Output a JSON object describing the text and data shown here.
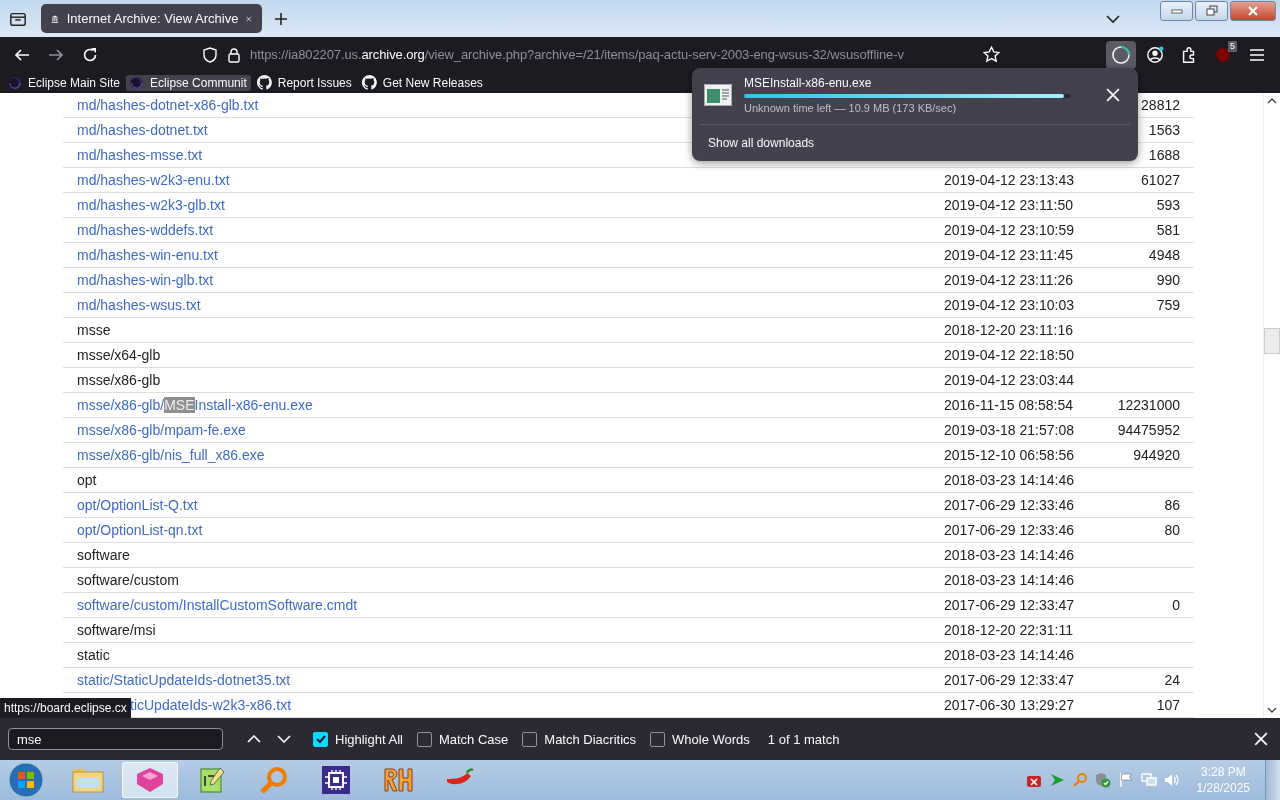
{
  "tabs": [
    {
      "title": "Internet Archive: View Archive",
      "selected": true
    }
  ],
  "url": {
    "prefix": "https://ia802207.us.",
    "domain": "archive.org",
    "path": "/view_archive.php?archive=/21/items/paq-actu-serv-2003-eng-wsus-32/wsusoffline-v"
  },
  "bookmarks": [
    {
      "label": "Eclipse Main Site",
      "kind": "eclipse",
      "hovered": false
    },
    {
      "label": "Eclipse Communit",
      "kind": "eclipse",
      "hovered": true
    },
    {
      "label": "Report Issues",
      "kind": "github",
      "hovered": false
    },
    {
      "label": "Get New Releases",
      "kind": "github",
      "hovered": false
    }
  ],
  "extension_badge": "5",
  "download": {
    "filename": "MSEInstall-x86-enu.exe",
    "level": 0.98,
    "status": "Unknown time left — 10.9 MB (173 KB/sec)",
    "show_all": "Show all downloads"
  },
  "rows": [
    {
      "kind": "file",
      "name": [
        {
          "text": "md/hashes-dotnet-x86-glb.txt",
          "highlighted": false
        }
      ],
      "size": "28812"
    },
    {
      "kind": "file",
      "name": [
        {
          "text": "md/hashes-dotnet.txt",
          "highlighted": false
        }
      ],
      "size": "1563"
    },
    {
      "kind": "file",
      "name": [
        {
          "text": "md/hashes-msse.txt",
          "highlighted": false
        }
      ],
      "size": "1688"
    },
    {
      "kind": "file",
      "name": [
        {
          "text": "md/hashes-w2k3-enu.txt",
          "highlighted": false
        }
      ],
      "date": "2019-04-12 23:13:43",
      "size": "61027"
    },
    {
      "kind": "file",
      "name": [
        {
          "text": "md/hashes-w2k3-glb.txt",
          "highlighted": false
        }
      ],
      "date": "2019-04-12 23:11:50",
      "size": "593"
    },
    {
      "kind": "file",
      "name": [
        {
          "text": "md/hashes-wddefs.txt",
          "highlighted": false
        }
      ],
      "date": "2019-04-12 23:10:59",
      "size": "581"
    },
    {
      "kind": "file",
      "name": [
        {
          "text": "md/hashes-win-enu.txt",
          "highlighted": false
        }
      ],
      "date": "2019-04-12 23:11:45",
      "size": "4948"
    },
    {
      "kind": "file",
      "name": [
        {
          "text": "md/hashes-win-glb.txt",
          "highlighted": false
        }
      ],
      "date": "2019-04-12 23:11:26",
      "size": "990"
    },
    {
      "kind": "file",
      "name": [
        {
          "text": "md/hashes-wsus.txt",
          "highlighted": false
        }
      ],
      "date": "2019-04-12 23:10:03",
      "size": "759"
    },
    {
      "kind": "folder",
      "name": [
        {
          "text": "msse",
          "highlighted": false
        }
      ],
      "date": "2018-12-20 23:11:16"
    },
    {
      "kind": "folder",
      "name": [
        {
          "text": "msse/x64-glb",
          "highlighted": false
        }
      ],
      "date": "2019-04-12 22:18:50"
    },
    {
      "kind": "folder",
      "name": [
        {
          "text": "msse/x86-glb",
          "highlighted": false
        }
      ],
      "date": "2019-04-12 23:03:44"
    },
    {
      "kind": "file",
      "name": [
        {
          "text": "msse/x86-glb/",
          "highlighted": false
        },
        {
          "text": "MSE",
          "highlighted": true
        },
        {
          "text": "Install-x86-enu.exe",
          "highlighted": false
        }
      ],
      "date": "2016-11-15 08:58:54",
      "size": "12231000"
    },
    {
      "kind": "file",
      "name": [
        {
          "text": "msse/x86-glb/mpam-fe.exe",
          "highlighted": false
        }
      ],
      "date": "2019-03-18 21:57:08",
      "size": "94475952"
    },
    {
      "kind": "file",
      "name": [
        {
          "text": "msse/x86-glb/nis_full_x86.exe",
          "highlighted": false
        }
      ],
      "date": "2015-12-10 06:58:56",
      "size": "944920"
    },
    {
      "kind": "folder",
      "name": [
        {
          "text": "opt",
          "highlighted": false
        }
      ],
      "date": "2018-03-23 14:14:46"
    },
    {
      "kind": "file",
      "name": [
        {
          "text": "opt/OptionList-Q.txt",
          "highlighted": false
        }
      ],
      "date": "2017-06-29 12:33:46",
      "size": "86"
    },
    {
      "kind": "file",
      "name": [
        {
          "text": "opt/OptionList-qn.txt",
          "highlighted": false
        }
      ],
      "date": "2017-06-29 12:33:46",
      "size": "80"
    },
    {
      "kind": "folder",
      "name": [
        {
          "text": "software",
          "highlighted": false
        }
      ],
      "date": "2018-03-23 14:14:46"
    },
    {
      "kind": "folder",
      "name": [
        {
          "text": "software/custom",
          "highlighted": false
        }
      ],
      "date": "2018-03-23 14:14:46"
    },
    {
      "kind": "file",
      "name": [
        {
          "text": "software/custom/InstallCustomSoftware.cmdt",
          "highlighted": false
        }
      ],
      "date": "2017-06-29 12:33:47",
      "size": "0"
    },
    {
      "kind": "folder",
      "name": [
        {
          "text": "software/msi",
          "highlighted": false
        }
      ],
      "date": "2018-12-20 22:31:11"
    },
    {
      "kind": "folder",
      "name": [
        {
          "text": "static",
          "highlighted": false
        }
      ],
      "date": "2018-03-23 14:14:46"
    },
    {
      "kind": "file",
      "name": [
        {
          "text": "static/StaticUpdateIds-dotnet35.txt",
          "highlighted": false
        }
      ],
      "date": "2017-06-29 12:33:47",
      "size": "24"
    },
    {
      "kind": "file",
      "name": [
        {
          "text": "ticUpdateIds-w2k3-x86.txt",
          "highlighted": false
        }
      ],
      "date": "2017-06-30 13:29:27",
      "size": "107",
      "covered_by_status": true
    }
  ],
  "status_link": "https://board.eclipse.cx",
  "find_bar": {
    "value": "mse",
    "options": [
      {
        "label": "Highlight All",
        "checked": true
      },
      {
        "label": "Match Case",
        "checked": false
      },
      {
        "label": "Match Diacritics",
        "checked": false
      },
      {
        "label": "Whole Words",
        "checked": false
      }
    ],
    "result": "1 of 1 match"
  },
  "taskbar": {
    "apps": [
      {
        "kind": "folder",
        "selected": false
      },
      {
        "kind": "box",
        "selected": true
      },
      {
        "kind": "notepad",
        "selected": false
      },
      {
        "kind": "magnifier",
        "selected": false
      },
      {
        "kind": "chip",
        "selected": false
      },
      {
        "kind": "rh",
        "selected": false
      },
      {
        "kind": "pepper",
        "selected": false
      }
    ],
    "time": "3:28 PM",
    "date": "1/28/2025"
  }
}
